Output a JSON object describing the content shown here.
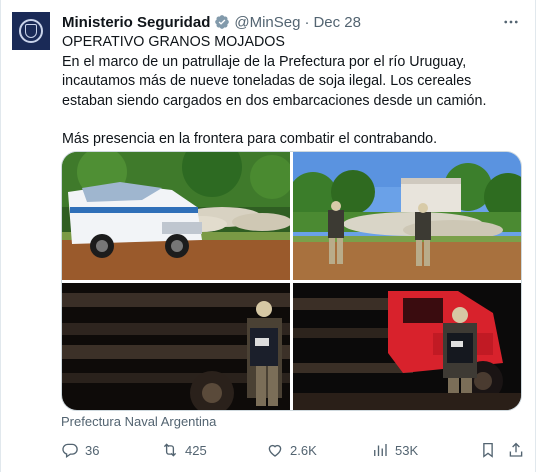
{
  "author": {
    "name": "Ministerio Seguridad",
    "handle": "@MinSeg",
    "separator": "·",
    "date": "Dec 28",
    "verified_badge_color": "#829aab"
  },
  "more_menu": {
    "icon": "more-horizontal-icon"
  },
  "body": {
    "line1": "OPERATIVO GRANOS MOJADOS",
    "line2": "En el marco de un patrullaje de la Prefectura por el río Uruguay, incautamos más de nueve toneladas de soja ilegal. Los cereales estaban siendo cargados en dos embarcaciones desde un camión.",
    "line3": "Más presencia en la frontera para combatir el contrabando."
  },
  "media": {
    "caption": "Prefectura Naval Argentina",
    "photos": [
      {
        "description_icon": "photo-truck-soy-bags"
      },
      {
        "description_icon": "photo-officers-soy-pile"
      },
      {
        "description_icon": "photo-night-truck-officer"
      },
      {
        "description_icon": "photo-night-red-truck-officer"
      }
    ]
  },
  "actions": {
    "replies": "36",
    "reposts": "425",
    "likes": "2.6K",
    "views": "53K"
  },
  "colors": {
    "text": "#0f1419",
    "secondary": "#536471",
    "border": "#cfd9de"
  }
}
